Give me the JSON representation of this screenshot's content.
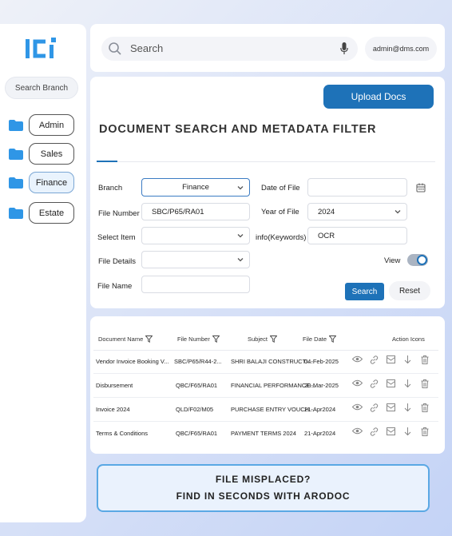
{
  "colors": {
    "accent": "#1e72b8",
    "folder": "#2f96e6",
    "logo": "#2f96e6"
  },
  "sidebar": {
    "search_branch": "Search Branch",
    "branches": [
      {
        "label": "Admin",
        "icon": "folder-icon"
      },
      {
        "label": "Sales",
        "icon": "folder-icon"
      },
      {
        "label": "Finance",
        "icon": "folder-icon",
        "active": true
      },
      {
        "label": "Estate",
        "icon": "folder-icon"
      }
    ]
  },
  "topbar": {
    "search_placeholder": "Search",
    "user": "admin@dms.com"
  },
  "filter": {
    "upload_label": "Upload Docs",
    "title": "DOCUMENT SEARCH AND METADATA FILTER",
    "branch_label": "Branch",
    "branch_value": "Finance",
    "date_label": "Date of File",
    "date_value": "",
    "file_number_label": "File Number",
    "file_number_value": "SBC/P65/RA01",
    "year_label": "Year of File",
    "year_value": "2024",
    "select_item_label": "Select Item",
    "select_item_value": "",
    "info_label": "info(Keywords)",
    "info_value": "OCR",
    "file_details_label": "File Details",
    "file_details_value": "",
    "view_label": "View",
    "view_on": true,
    "file_name_label": "File Name",
    "file_name_value": "",
    "search_label": "Search",
    "reset_label": "Reset"
  },
  "table": {
    "headers": {
      "document_name": "Document Name",
      "file_number": "File Number",
      "subject": "Subject",
      "file_date": "File Date",
      "action_icons": "Action Icons"
    },
    "rows": [
      {
        "name": "Vendor Invoice Booking V...",
        "number": "SBC/P65/R44-2...",
        "subject": "SHRI BALAJI CONSTRUCTI...",
        "date": "04-Feb-2025"
      },
      {
        "name": "Disbursement",
        "number": "QBC/F65/RA01",
        "subject": "FINANCIAL PERFORMANCE...",
        "date": "20-Mar-2025"
      },
      {
        "name": "Invoice 2024",
        "number": "QLD/F02/M05",
        "subject": "PURCHASE ENTRY VOUCH...",
        "date": "21-Apr2024"
      },
      {
        "name": "Terms & Conditions",
        "number": "QBC/F65/RA01",
        "subject": "PAYMENT TERMS 2024",
        "date": "21-Apr2024"
      }
    ]
  },
  "banner": {
    "line1": "FILE MISPLACED?",
    "line2": "FIND IN SECONDS WITH ARODOC"
  }
}
